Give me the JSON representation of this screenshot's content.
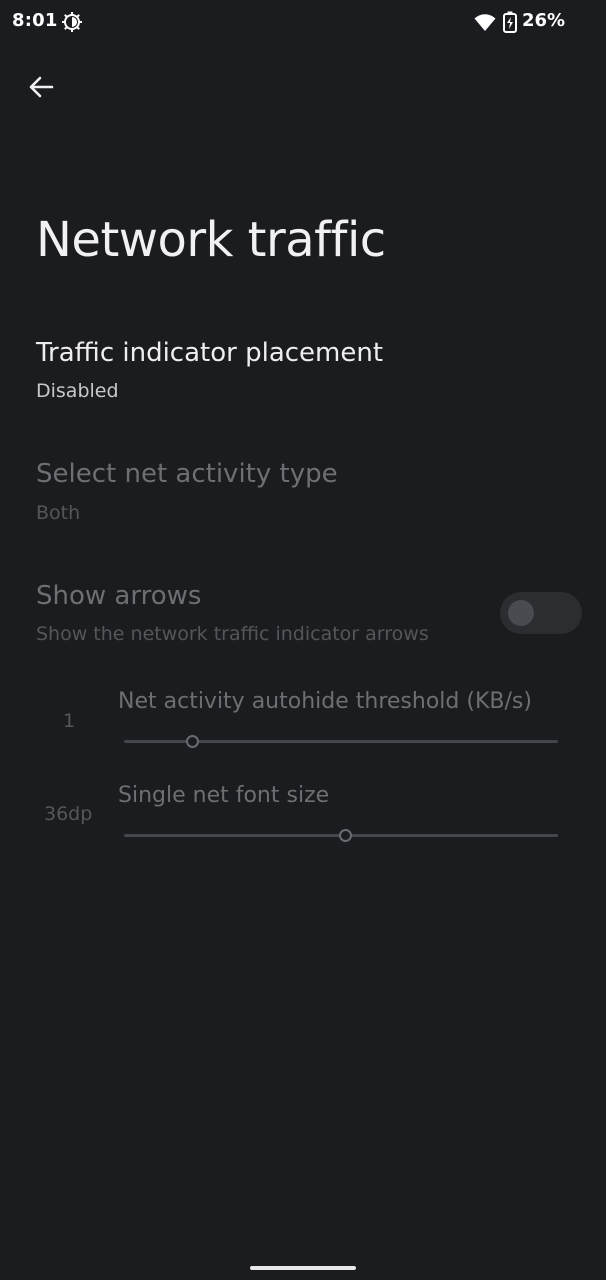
{
  "status_bar": {
    "time": "8:01",
    "battery_percent": "26%",
    "icons": [
      "sync-icon",
      "wifi-icon",
      "battery-charging-icon"
    ]
  },
  "header": {
    "back_icon": "arrow-left-icon",
    "title": "Network traffic"
  },
  "preferences": [
    {
      "title": "Traffic indicator placement",
      "summary": "Disabled",
      "enabled": true
    },
    {
      "title": "Select net activity type",
      "summary": "Both",
      "enabled": false
    },
    {
      "title": "Show arrows",
      "summary": "Show the network traffic indicator arrows",
      "enabled": false,
      "toggle_on": false
    }
  ],
  "sliders": [
    {
      "title": "Net activity autohide threshold (KB/s)",
      "value_label": "1",
      "fraction": 0.1,
      "enabled": false
    },
    {
      "title": "Single net font size",
      "value_label": "36dp",
      "fraction": 0.5,
      "enabled": false
    }
  ],
  "colors": {
    "background": "#1b1c20",
    "text_primary": "#eeeef1",
    "text_disabled": "#6e6f73"
  }
}
